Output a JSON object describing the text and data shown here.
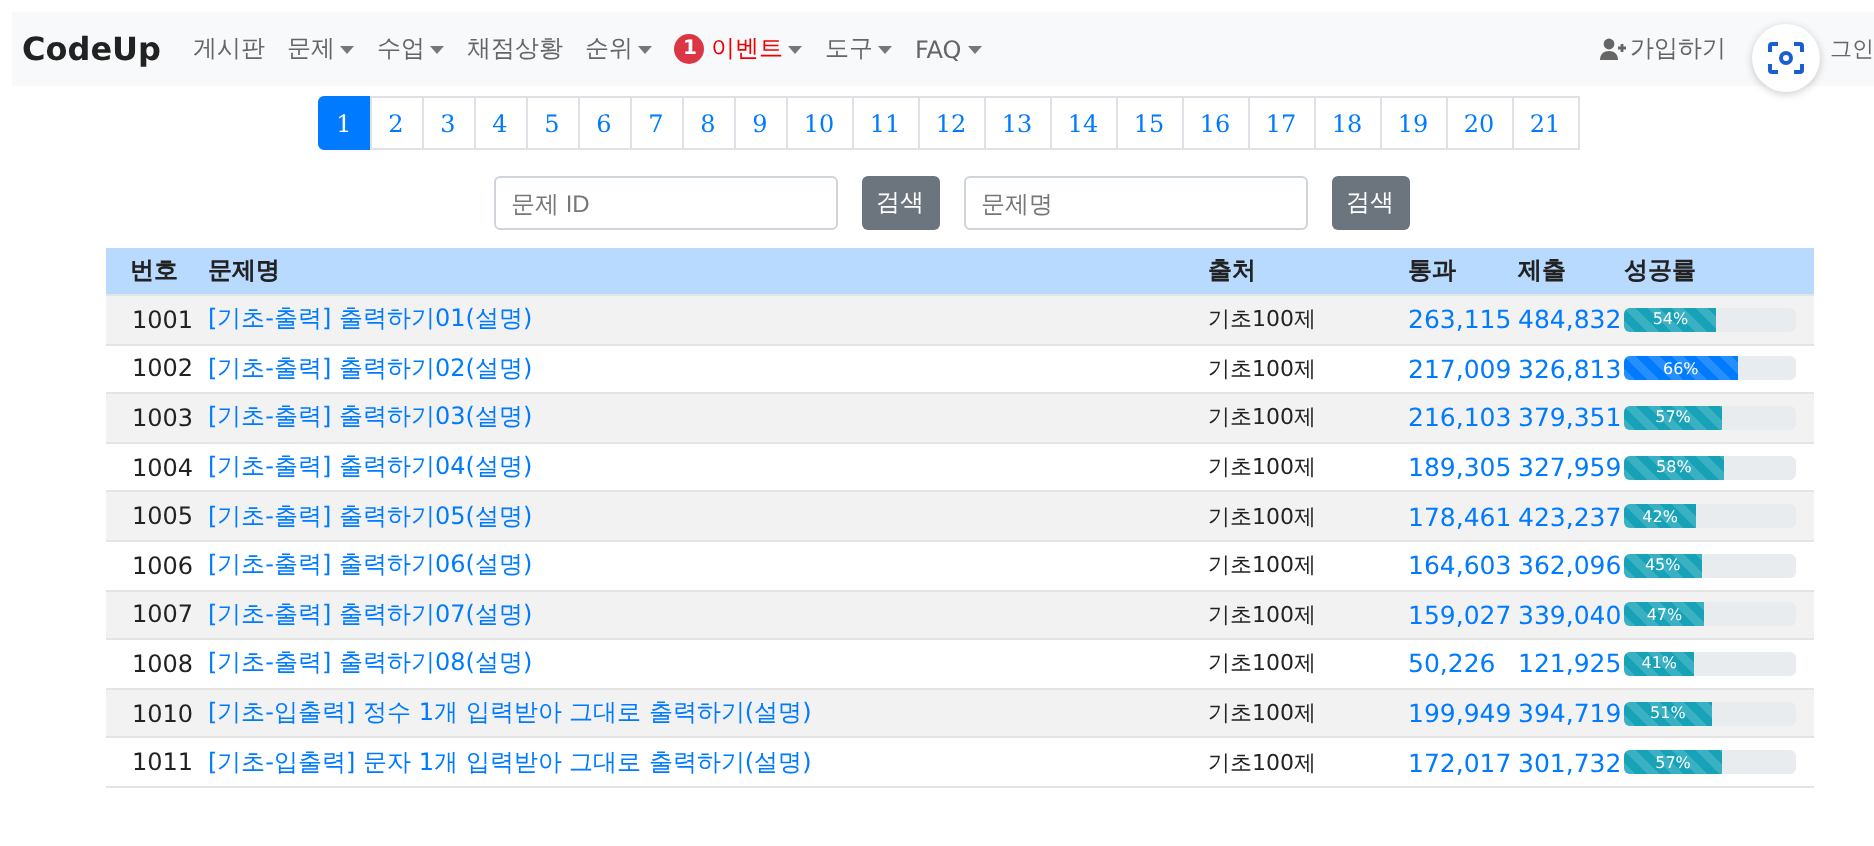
{
  "navbar": {
    "brand": "CodeUp",
    "items": [
      {
        "label": "게시판",
        "dropdown": false,
        "highlight": false
      },
      {
        "label": "문제",
        "dropdown": true,
        "highlight": false
      },
      {
        "label": "수업",
        "dropdown": true,
        "highlight": false
      },
      {
        "label": "채점상황",
        "dropdown": false,
        "highlight": false
      },
      {
        "label": "순위",
        "dropdown": true,
        "highlight": false
      },
      {
        "label": "이벤트",
        "dropdown": true,
        "badge": "1",
        "highlight": true
      },
      {
        "label": "도구",
        "dropdown": true,
        "highlight": false
      },
      {
        "label": "FAQ",
        "dropdown": true,
        "highlight": false
      }
    ],
    "signup": "가입하기",
    "login": "그인"
  },
  "pagination": [
    {
      "label": "1",
      "selected": true
    },
    {
      "label": "2",
      "selected": false
    },
    {
      "label": "3",
      "selected": false
    },
    {
      "label": "4",
      "selected": false
    },
    {
      "label": "5",
      "selected": false
    },
    {
      "label": "6",
      "selected": false
    },
    {
      "label": "7",
      "selected": false
    },
    {
      "label": "8",
      "selected": false
    },
    {
      "label": "9",
      "selected": false
    },
    {
      "label": "10",
      "selected": false
    },
    {
      "label": "11",
      "selected": false
    },
    {
      "label": "12",
      "selected": false
    },
    {
      "label": "13",
      "selected": false
    },
    {
      "label": "14",
      "selected": false
    },
    {
      "label": "15",
      "selected": false
    },
    {
      "label": "16",
      "selected": false
    },
    {
      "label": "17",
      "selected": false
    },
    {
      "label": "18",
      "selected": false
    },
    {
      "label": "19",
      "selected": false
    },
    {
      "label": "20",
      "selected": false
    },
    {
      "label": "21",
      "selected": false
    }
  ],
  "search": [
    {
      "placeholder": "문제 ID",
      "button": "검색"
    },
    {
      "placeholder": "문제명",
      "button": "검색"
    }
  ],
  "table": {
    "columns": [
      "번호",
      "문제명",
      "출처",
      "통과",
      "제출",
      "성공률"
    ],
    "rows": [
      {
        "id": "1001",
        "title": "[기초-출력] 출력하기01(설명)",
        "source": "기초100제",
        "passed": "263,115",
        "submitted": "484,832",
        "rate": "54%",
        "level": 0.54,
        "color": "#17a2b8"
      },
      {
        "id": "1002",
        "title": "[기초-출력] 출력하기02(설명)",
        "source": "기초100제",
        "passed": "217,009",
        "submitted": "326,813",
        "rate": "66%",
        "level": 0.66,
        "color": "#007bff"
      },
      {
        "id": "1003",
        "title": "[기초-출력] 출력하기03(설명)",
        "source": "기초100제",
        "passed": "216,103",
        "submitted": "379,351",
        "rate": "57%",
        "level": 0.57,
        "color": "#17a2b8"
      },
      {
        "id": "1004",
        "title": "[기초-출력] 출력하기04(설명)",
        "source": "기초100제",
        "passed": "189,305",
        "submitted": "327,959",
        "rate": "58%",
        "level": 0.58,
        "color": "#17a2b8"
      },
      {
        "id": "1005",
        "title": "[기초-출력] 출력하기05(설명)",
        "source": "기초100제",
        "passed": "178,461",
        "submitted": "423,237",
        "rate": "42%",
        "level": 0.42,
        "color": "#17a2b8"
      },
      {
        "id": "1006",
        "title": "[기초-출력] 출력하기06(설명)",
        "source": "기초100제",
        "passed": "164,603",
        "submitted": "362,096",
        "rate": "45%",
        "level": 0.45,
        "color": "#17a2b8"
      },
      {
        "id": "1007",
        "title": "[기초-출력] 출력하기07(설명)",
        "source": "기초100제",
        "passed": "159,027",
        "submitted": "339,040",
        "rate": "47%",
        "level": 0.47,
        "color": "#17a2b8"
      },
      {
        "id": "1008",
        "title": "[기초-출력] 출력하기08(설명)",
        "source": "기초100제",
        "passed": "50,226",
        "submitted": "121,925",
        "rate": "41%",
        "level": 0.41,
        "color": "#17a2b8"
      },
      {
        "id": "1010",
        "title": "[기초-입출력] 정수 1개 입력받아 그대로 출력하기(설명)",
        "source": "기초100제",
        "passed": "199,949",
        "submitted": "394,719",
        "rate": "51%",
        "level": 0.51,
        "color": "#17a2b8"
      },
      {
        "id": "1011",
        "title": "[기초-입출력] 문자 1개 입력받아 그대로 출력하기(설명)",
        "source": "기초100제",
        "passed": "172,017",
        "submitted": "301,732",
        "rate": "57%",
        "level": 0.57,
        "color": "#17a2b8"
      }
    ]
  }
}
